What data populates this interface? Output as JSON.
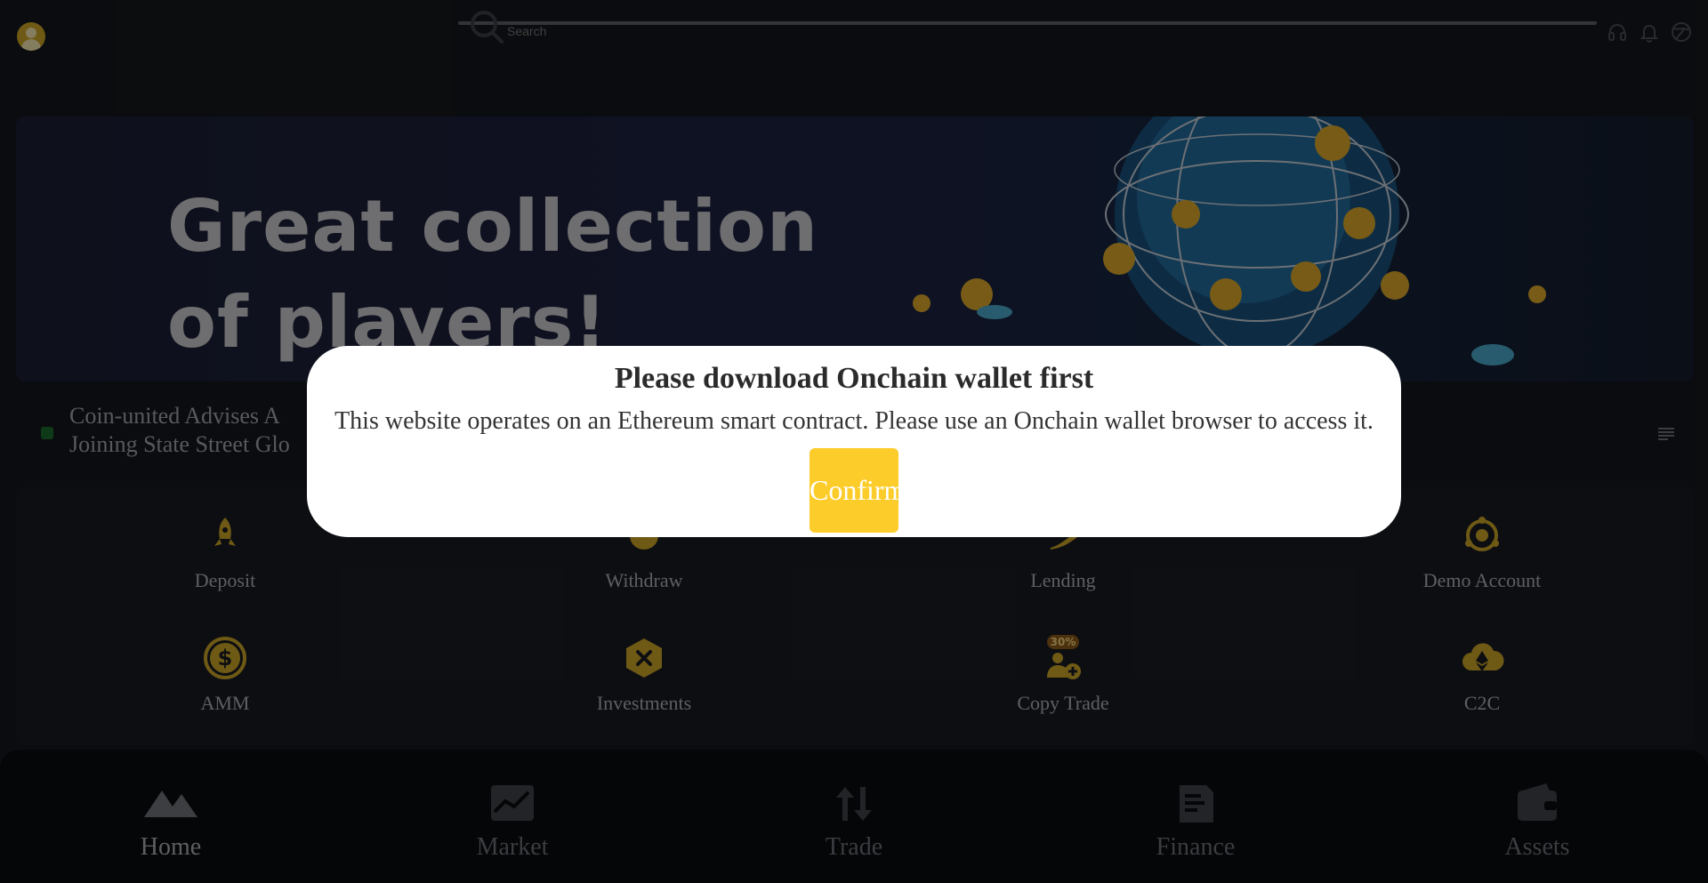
{
  "topbar": {
    "search_placeholder": "Search",
    "icons": [
      "headset-icon",
      "bell-icon",
      "globe-icon"
    ]
  },
  "banner": {
    "title_line1": "Great collection",
    "title_line2": "of players!"
  },
  "ticker": {
    "news_line1": "Coin-united Advises A",
    "news_line2": "Joining State Street Glo"
  },
  "features": [
    {
      "label": "Deposit",
      "icon": "rocket-icon"
    },
    {
      "label": "Withdraw",
      "icon": "withdraw-icon"
    },
    {
      "label": "Lending",
      "icon": "lending-icon"
    },
    {
      "label": "Demo Account",
      "icon": "demo-account-icon"
    },
    {
      "label": "AMM",
      "icon": "dollar-coin-icon"
    },
    {
      "label": "Investments",
      "icon": "investments-icon"
    },
    {
      "label": "Copy Trade",
      "icon": "copy-trade-icon",
      "badge": "30%"
    },
    {
      "label": "C2C",
      "icon": "cloud-ethereum-icon"
    }
  ],
  "bottom_nav": [
    {
      "label": "Home",
      "icon": "home-mountain-icon",
      "active": true
    },
    {
      "label": "Market",
      "icon": "market-chart-icon"
    },
    {
      "label": "Trade",
      "icon": "trade-arrows-icon"
    },
    {
      "label": "Finance",
      "icon": "finance-document-icon"
    },
    {
      "label": "Assets",
      "icon": "wallet-icon"
    }
  ],
  "modal": {
    "title": "Please download Onchain wallet first",
    "body": "This website operates on an Ethereum smart contract. Please use an Onchain wallet browser to access it.",
    "confirm_label": "Confirm"
  },
  "colors": {
    "accent": "#fccc2a",
    "icon_gold": "#c9a227",
    "background": "#15171c"
  }
}
